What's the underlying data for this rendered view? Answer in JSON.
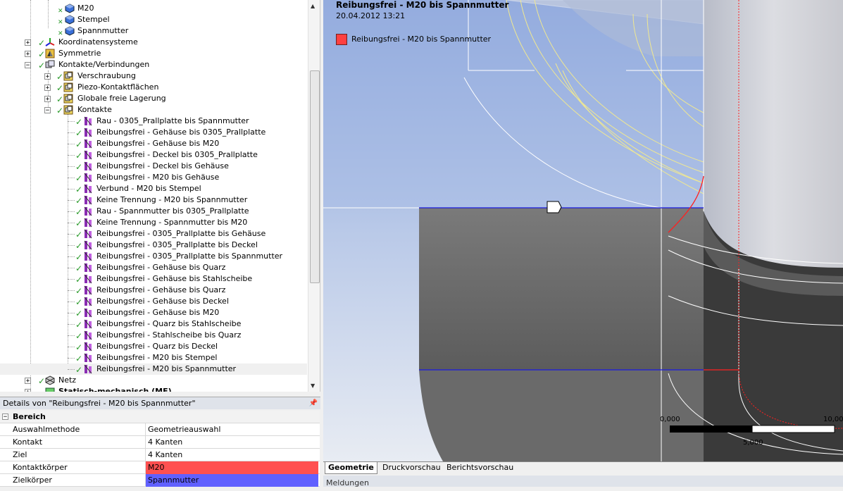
{
  "tree": {
    "items": [
      {
        "label": "M20",
        "icon": "part-icon"
      },
      {
        "label": "Stempel",
        "icon": "part-icon"
      },
      {
        "label": "Spannmutter",
        "icon": "part-icon"
      },
      {
        "label": "Koordinatensysteme",
        "icon": "coordinate-system-icon"
      },
      {
        "label": "Symmetrie",
        "icon": "symmetry-icon"
      },
      {
        "label": "Kontakte/Verbindungen",
        "icon": "connections-icon"
      },
      {
        "label": "Verschraubung",
        "icon": "connection-group-icon"
      },
      {
        "label": "Piezo-Kontaktflächen",
        "icon": "connection-group-icon"
      },
      {
        "label": "Globale freie Lagerung",
        "icon": "connection-group-icon"
      },
      {
        "label": "Kontakte",
        "icon": "connection-group-icon"
      }
    ],
    "contacts": [
      "Rau - 0305_Prallplatte bis Spannmutter",
      "Reibungsfrei - Gehäuse bis 0305_Prallplatte",
      "Reibungsfrei - Gehäuse bis M20",
      "Reibungsfrei - Deckel bis 0305_Prallplatte",
      "Reibungsfrei - Deckel bis Gehäuse",
      "Reibungsfrei - M20 bis Gehäuse",
      "Verbund - M20 bis Stempel",
      "Keine Trennung - M20 bis Spannmutter",
      "Rau - Spannmutter bis 0305_Prallplatte",
      "Keine Trennung - Spannmutter bis M20",
      "Reibungsfrei - 0305_Prallplatte bis Gehäuse",
      "Reibungsfrei - 0305_Prallplatte bis Deckel",
      "Reibungsfrei - 0305_Prallplatte bis Spannmutter",
      "Reibungsfrei - Gehäuse bis Quarz",
      "Reibungsfrei - Gehäuse bis Stahlscheibe",
      "Reibungsfrei - Gehäuse bis Quarz",
      "Reibungsfrei - Gehäuse bis Deckel",
      "Reibungsfrei - Gehäuse bis M20",
      "Reibungsfrei - Quarz bis Stahlscheibe",
      "Reibungsfrei - Stahlscheibe bis Quarz",
      "Reibungsfrei - Quarz bis Deckel",
      "Reibungsfrei - M20 bis Stempel",
      "Reibungsfrei - M20 bis Spannmutter"
    ],
    "netz": "Netz",
    "static": "Statisch-mechanisch (ME)"
  },
  "details": {
    "title": "Details von \"Reibungsfrei - M20 bis Spannmutter\"",
    "section": "Bereich",
    "rows": [
      {
        "key": "Auswahlmethode",
        "value": "Geometrieauswahl"
      },
      {
        "key": "Kontakt",
        "value": "4 Kanten"
      },
      {
        "key": "Ziel",
        "value": "4 Kanten"
      },
      {
        "key": "Kontaktkörper",
        "value": "M20"
      },
      {
        "key": "Zielkörper",
        "value": "Spannmutter"
      }
    ],
    "contact_color": "#ff5050",
    "target_color": "#6060ff"
  },
  "viewport": {
    "title": "Reibungsfrei - M20 bis Spannmutter",
    "date": "20.04.2012 13:21",
    "legend_label": "Reibungsfrei - M20 bis Spannmutter",
    "legend_color": "#ff4040",
    "scale_0": "0,000",
    "scale_5": "5,000",
    "scale_10": "10,00"
  },
  "tabs": [
    "Geometrie",
    "Druckvorschau",
    "Berichtsvorschau"
  ],
  "messages_label": "Meldungen"
}
